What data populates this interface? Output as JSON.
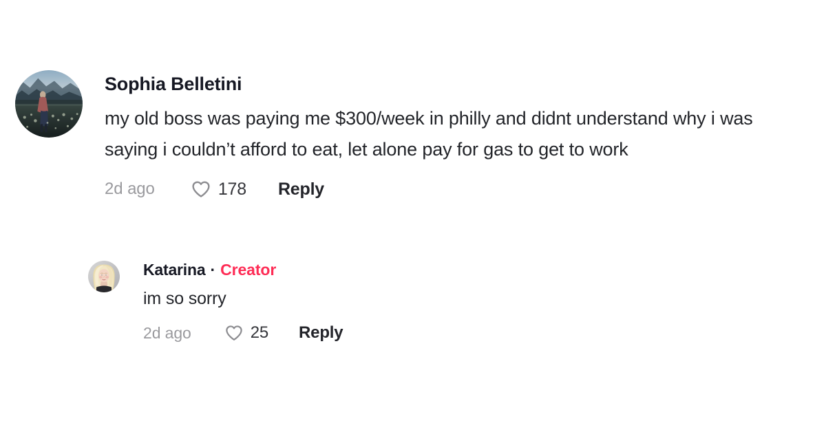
{
  "thread": {
    "background_color": "#ffffff",
    "creator_badge_color": "#fe2c55",
    "comments": [
      {
        "id": "root-comment",
        "author": "Sophia Belletini",
        "is_creator": false,
        "avatar_icon": "user-avatar-landscape-photo",
        "text": "my old boss was paying me $300/week in philly and didnt understand why i was saying i couldn’t afford to eat, let alone pay for gas to get to work",
        "timestamp": "2d ago",
        "like_icon": "heart-outline-icon",
        "like_count": "178",
        "reply_label": "Reply"
      },
      {
        "id": "reply-comment",
        "author": "Katarina",
        "is_creator": true,
        "separator": "·",
        "creator_label": "Creator",
        "avatar_icon": "user-avatar-portrait-photo",
        "text": "im so sorry",
        "timestamp": "2d ago",
        "like_icon": "heart-outline-icon",
        "like_count": "25",
        "reply_label": "Reply"
      }
    ]
  }
}
